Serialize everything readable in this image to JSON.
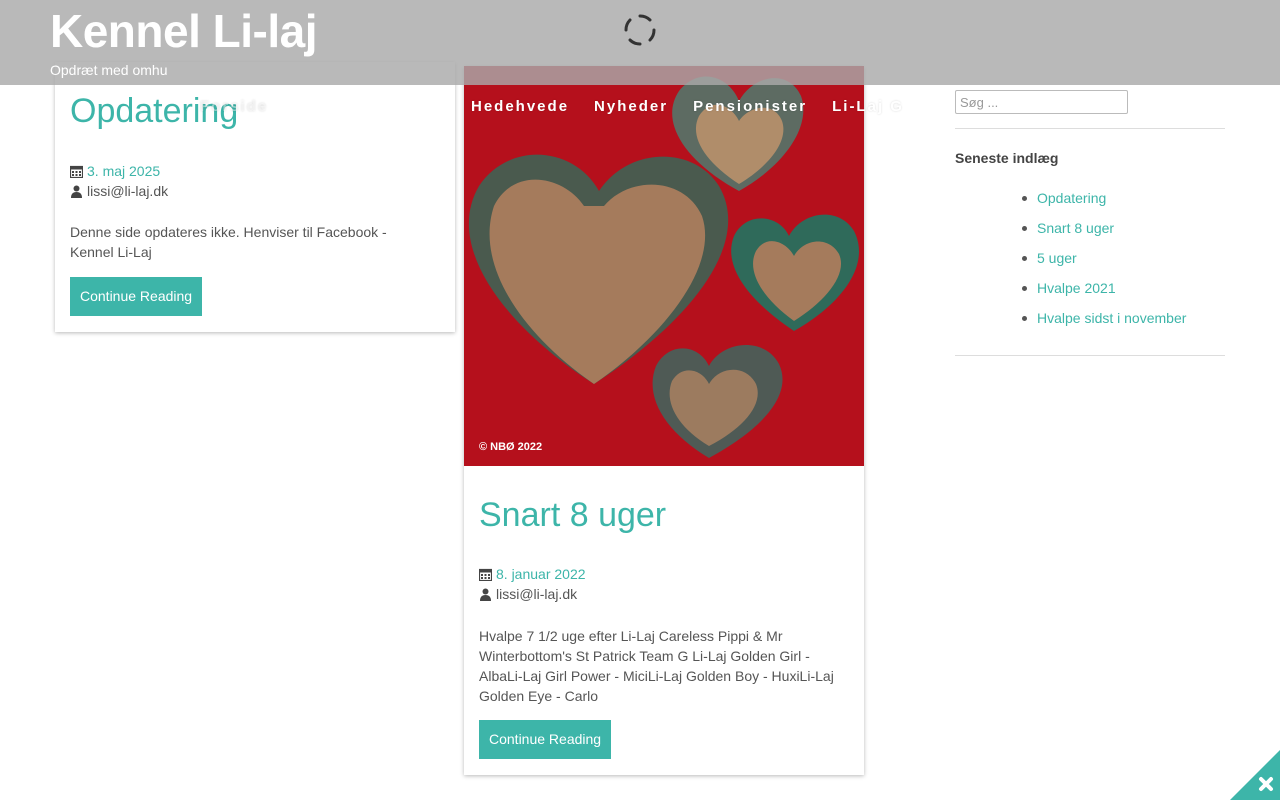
{
  "site": {
    "title": "Kennel Li-laj",
    "tagline": "Opdræt med omhu"
  },
  "nav": {
    "items": [
      {
        "label": "Forside"
      },
      {
        "label": "Hedehvede"
      },
      {
        "label": "Nyheder"
      },
      {
        "label": "Pensionister"
      },
      {
        "label": "Li-Laj G"
      }
    ]
  },
  "posts": [
    {
      "title": "Opdatering",
      "date": "3. maj 2025",
      "author": "lissi@li-laj.dk",
      "excerpt": "Denne side opdateres ikke. Henviser til Facebook - Kennel Li-Laj",
      "button": "Continue Reading"
    },
    {
      "title": "Snart 8 uger",
      "date": "8. januar 2022",
      "author": "lissi@li-laj.dk",
      "excerpt": "Hvalpe 7 1/2 uge efter Li-Laj Careless Pippi & Mr Winterbottom's St Patrick Team G Li-Laj Golden Girl - AlbaLi-Laj Girl Power - MiciLi-Laj Golden Boy - HuxiLi-Laj Golden Eye - Carlo",
      "button": "Continue Reading",
      "image_caption": "© NBØ 2022"
    }
  ],
  "sidebar": {
    "search_placeholder": "Søg ...",
    "recent_title": "Seneste indlæg",
    "recent": [
      {
        "label": "Opdatering"
      },
      {
        "label": "Snart 8 uger"
      },
      {
        "label": "5 uger"
      },
      {
        "label": "Hvalpe 2021"
      },
      {
        "label": "Hvalpe sidst i november"
      }
    ]
  },
  "colors": {
    "accent": "#3db5a9",
    "header_overlay": "#aaaaaa",
    "image_background": "#b5101c"
  },
  "icons": {
    "date": "calendar-icon",
    "author": "user-icon",
    "loading": "spinner-icon",
    "corner": "close-icon"
  }
}
